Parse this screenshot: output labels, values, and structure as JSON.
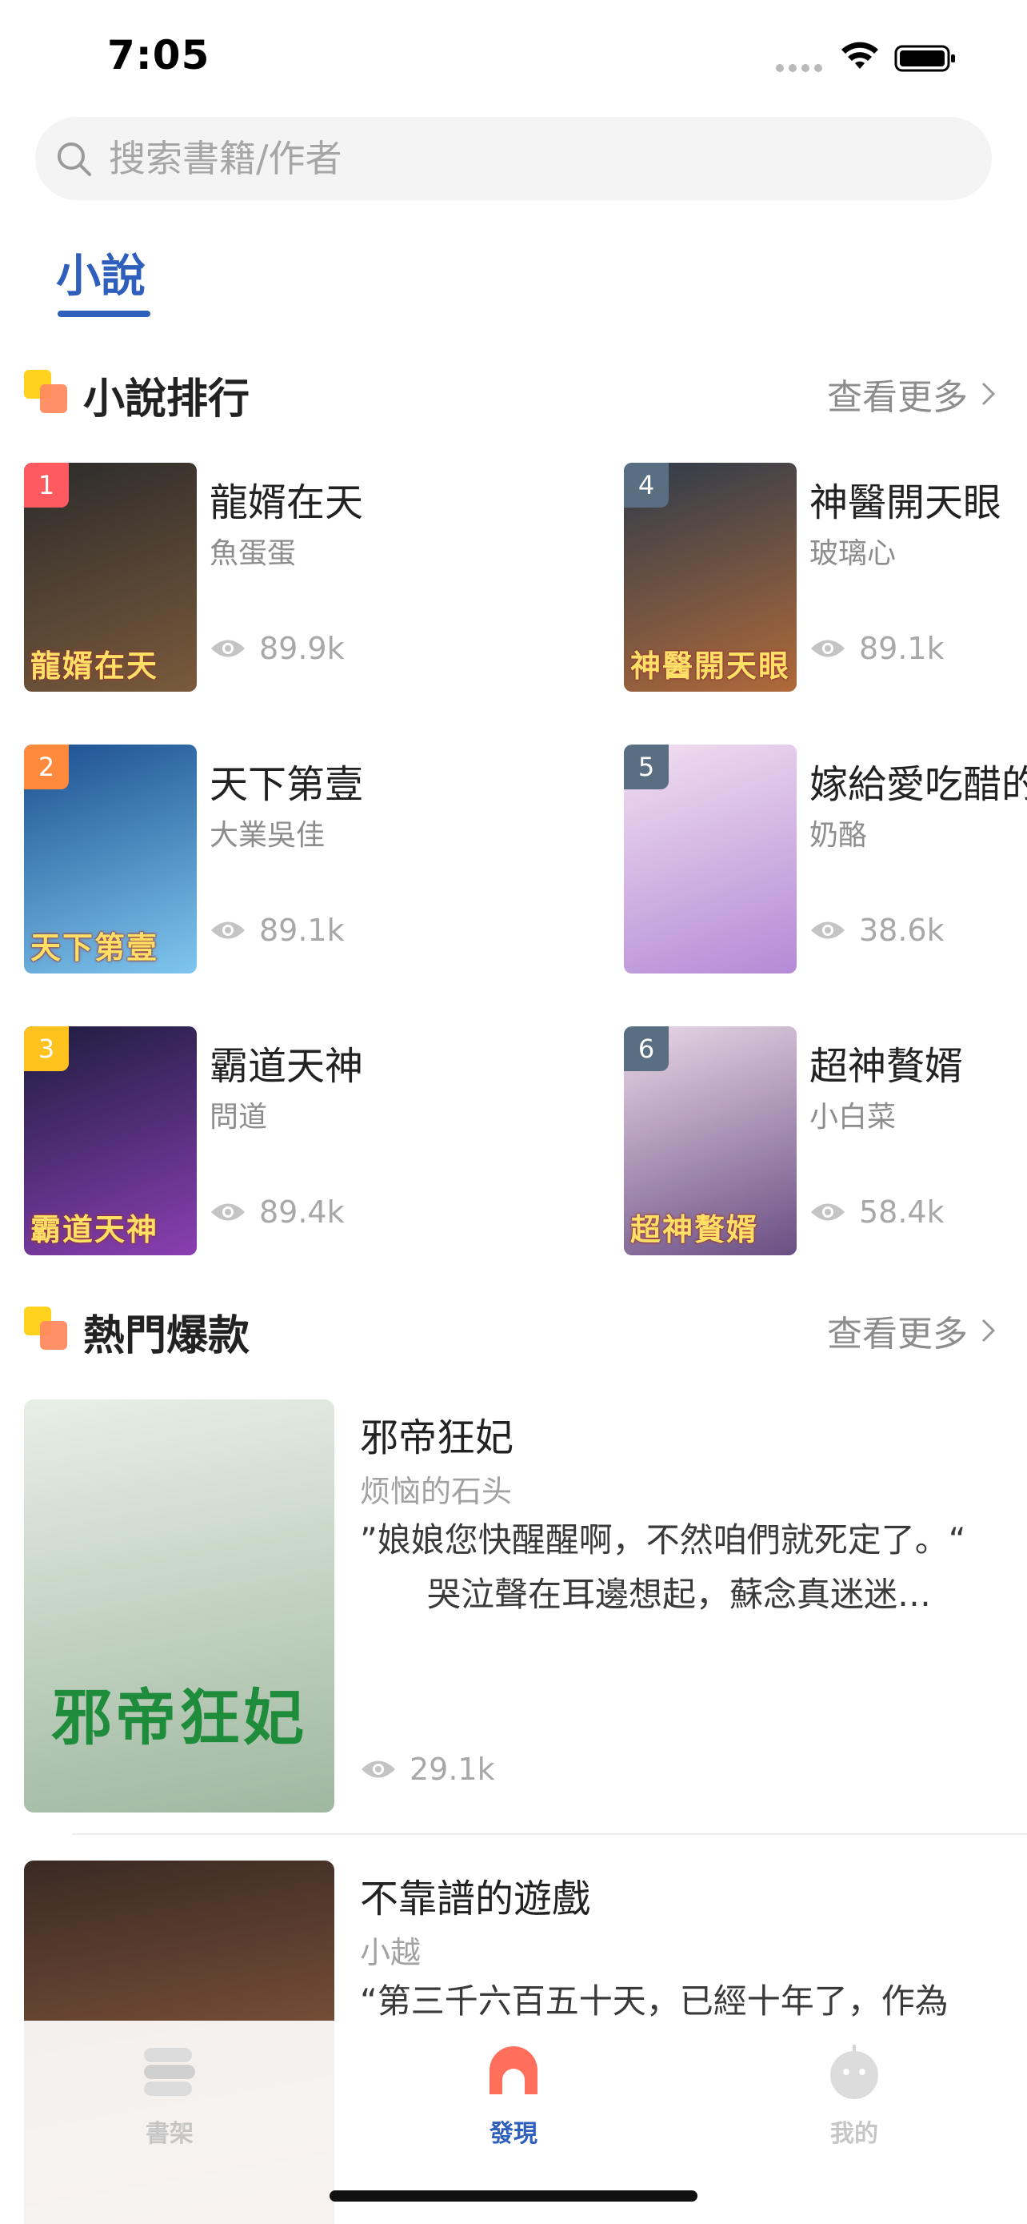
{
  "status_bar": {
    "time": "7:05"
  },
  "search": {
    "placeholder": "搜索書籍/作者"
  },
  "tabs": [
    {
      "label": "小說",
      "active": true
    }
  ],
  "ranking": {
    "title": "小說排行",
    "more_label": "查看更多",
    "items": [
      {
        "rank": "1",
        "title": "龍婿在天",
        "author": "魚蛋蛋",
        "views": "89.9k",
        "badge_color": "#ff5a5f",
        "cover_colors": [
          "#2b2b2b",
          "#7a5a3b"
        ],
        "cover_text": "龍婿在天"
      },
      {
        "rank": "2",
        "title": "天下第壹",
        "author": "大業吳佳",
        "views": "89.1k",
        "badge_color": "#ff8a3d",
        "cover_colors": [
          "#1b4f8f",
          "#7fc7ef"
        ],
        "cover_text": "天下第壹"
      },
      {
        "rank": "3",
        "title": "霸道天神",
        "author": "問道",
        "views": "89.4k",
        "badge_color": "#ffc21f",
        "cover_colors": [
          "#1d1d3f",
          "#8a3fb2"
        ],
        "cover_text": "霸道天神"
      },
      {
        "rank": "4",
        "title": "神醫開天眼",
        "author": "玻璃心",
        "views": "89.1k",
        "badge_color": "#5a6e82",
        "cover_colors": [
          "#2e3b4a",
          "#b06a3a"
        ],
        "cover_text": "神醫開天眼"
      },
      {
        "rank": "5",
        "title": "嫁給愛吃醋的",
        "author": "奶酪",
        "views": "38.6k",
        "badge_color": "#5a6e82",
        "cover_colors": [
          "#f2dff0",
          "#b48ad6"
        ],
        "cover_text": ""
      },
      {
        "rank": "6",
        "title": "超神贅婿",
        "author": "小白菜",
        "views": "58.4k",
        "badge_color": "#5a6e82",
        "cover_colors": [
          "#e9d7e6",
          "#6a4f84"
        ],
        "cover_text": "超神贅婿"
      }
    ]
  },
  "hot": {
    "title": "熱門爆款",
    "more_label": "查看更多",
    "items": [
      {
        "title": "邪帝狂妃",
        "author": "烦恼的石头",
        "desc": "”娘娘您快醒醒啊，不然咱們就死定了。“\n　　哭泣聲在耳邊想起，蘇念真迷迷…",
        "views": "29.1k",
        "cover_colors": [
          "#e8efe6",
          "#9fb8a0"
        ],
        "cover_text": "邪帝狂妃"
      },
      {
        "title": "不靠譜的遊戲",
        "author": "小越",
        "desc": "“第三千六百五十天，已經十年了，作為",
        "views": "",
        "cover_colors": [
          "#3a2a24",
          "#b8754a"
        ],
        "cover_text": ""
      }
    ]
  },
  "bottom_nav": [
    {
      "label": "書架",
      "icon": "bookshelf-icon",
      "active": false
    },
    {
      "label": "發現",
      "icon": "discover-icon",
      "active": true
    },
    {
      "label": "我的",
      "icon": "profile-icon",
      "active": false
    }
  ],
  "colors": {
    "accent": "#2f5fbd",
    "discover_icon": "#ff6f5c"
  }
}
